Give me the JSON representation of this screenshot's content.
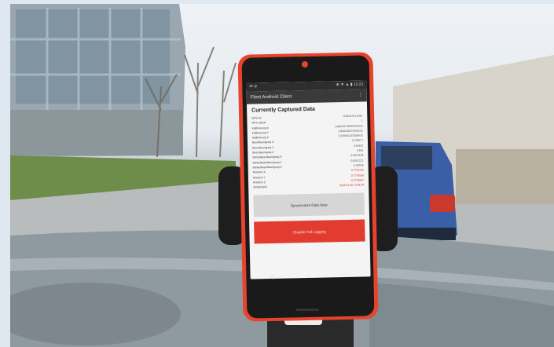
{
  "status_bar": {
    "left": "✉ ⊘",
    "right": "⊕ ▼ ▲ ▮ 12:21"
  },
  "app_bar": {
    "title": "Fleet Android Client",
    "menu_icon": "more-vert-icon"
  },
  "panel": {
    "title": "Currently Captured Data",
    "rows": [
      {
        "label": "GPS Fix",
        "value": "12345678 12345"
      },
      {
        "label": "GPS Status",
        "value": "1"
      },
      {
        "label": "Kalibrierung X",
        "value": "-0.86549726629925316"
      },
      {
        "label": "Kalibrierung Y",
        "value": "0.860530473926231"
      },
      {
        "label": "Kalibrierung Z",
        "value": "0.156661023186625"
      },
      {
        "label": "Beschleunigung X",
        "value": "0.700077"
      },
      {
        "label": "Beschleunigung Y",
        "value": "0.65322"
      },
      {
        "label": "Beschleunigung Z",
        "value": "9.816"
      },
      {
        "label": "Winkelbeschleunigung X",
        "value": "0.0012148"
      },
      {
        "label": "Winkelbeschleunigung Y",
        "value": "-0.0001221"
      },
      {
        "label": "Winkelbeschleunigung Z",
        "value": "-0.00018"
      },
      {
        "label": "Rotation X",
        "value": "0.7761155"
      },
      {
        "label": "Rotation Y",
        "value": "0.7776548"
      },
      {
        "label": "Rotation Z",
        "value": "0.7723667"
      },
      {
        "label": "Zeitstempel",
        "value": "2016-01-05 13:34:24"
      }
    ],
    "sync_button": "Synchronize Data Now",
    "stop_button": "Disable Full Logging"
  },
  "nav": {
    "back": "◁",
    "home": "○",
    "recent": "□"
  },
  "colors": {
    "phone_body": "#e8432d",
    "stop_button": "#e23b2f",
    "sky": "#eef2f6",
    "car": "#3b5fa6"
  }
}
